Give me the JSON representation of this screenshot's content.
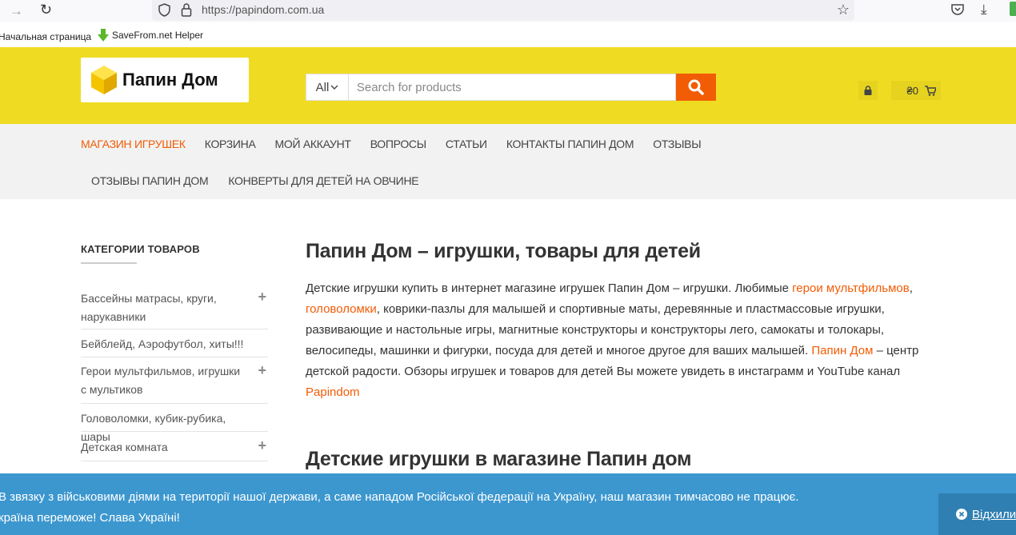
{
  "browser": {
    "url": "https://papindom.com.ua",
    "bookmarks": [
      "Начальная страница",
      "SaveFrom.net Helper"
    ]
  },
  "header": {
    "logo_text": "Папин Дом",
    "search": {
      "category": "All",
      "placeholder": "Search for products"
    },
    "cart_total": "₴0"
  },
  "nav": {
    "row1": [
      "МАГАЗИН ИГРУШЕК",
      "КОРЗИНА",
      "МОЙ АККАУНТ",
      "ВОПРОСЫ",
      "СТАТЬИ",
      "КОНТАКТЫ ПАПИН ДОМ",
      "ОТЗЫВЫ"
    ],
    "row2": [
      "ОТЗЫВЫ ПАПИН ДОМ",
      "КОНВЕРТЫ ДЛЯ ДЕТЕЙ НА ОВЧИНЕ"
    ]
  },
  "sidebar": {
    "title": "КАТЕГОРИИ ТОВАРОВ",
    "categories": [
      "Бассейны матрасы, круги, нарукавники",
      "Бейблейд, Аэрофутбол, хиты!!!",
      "Герои мультфильмов, игрушки с мультиков",
      "Головоломки, кубик-рубика, шары",
      "Детская комната"
    ]
  },
  "content": {
    "title": "Папин Дом – игрушки, товары для детей",
    "intro": {
      "t1": "Детские игрушки купить в интернет магазине игрушек Папин Дом – игрушки. Любимые ",
      "link1": "герои мультфильмов",
      "t2": ", ",
      "link2": "головоломки",
      "t3": ", коврики-пазлы для малышей и спортивные маты, деревянные и пластмассовые игрушки, развивающие и настольные игры, магнитные конструкторы и конструкторы лего, самокаты и толокары, велосипеды, машинки и фигурки, посуда для детей и многое другое для ваших малышей. ",
      "link3": "Папин Дом",
      "t4": " – центр детской радости. Обзоры игрушек и товаров для детей Вы можете увидеть в инстаграмм и YouTube канал ",
      "link4": "Papindom"
    },
    "subtitle": "Детские игрушки в магазине Папин дом"
  },
  "notice": {
    "line1": "В звязку з військовими діями на території нашої держави, а саме нападом Російської федерації на Україну, наш магазин тимчасово не працює.",
    "line2": "країна переможе! Слава Україні!",
    "dismiss": "Відхили"
  },
  "colors": {
    "header_bg": "#efdc22",
    "accent": "#f25c05",
    "notice_bg": "#3c97cf"
  }
}
